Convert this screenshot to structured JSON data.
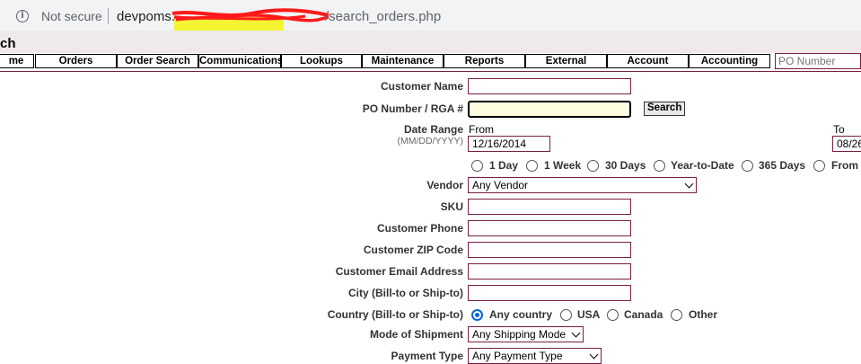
{
  "browser": {
    "not_secure": "Not secure",
    "url_host": "devpoms.",
    "url_path": "/search_orders.php"
  },
  "page": {
    "title": "ch"
  },
  "nav": {
    "items": [
      "me",
      "Orders",
      "Order Search",
      "Communications",
      "Lookups",
      "Maintenance",
      "Reports",
      "External",
      "Account",
      "Accounting"
    ],
    "po_placeholder": "PO Number"
  },
  "form": {
    "customer_name_label": "Customer Name",
    "po_label": "PO Number / RGA #",
    "search_button": "Search",
    "date_range_label": "Date Range",
    "date_format_hint": "(MM/DD/YYYY)",
    "from_label": "From",
    "from_value": "12/16/2014",
    "to_label": "To",
    "to_value": "08/26",
    "range_options": [
      "1 Day",
      "1 Week",
      "30 Days",
      "Year-to-Date",
      "365 Days",
      "From"
    ],
    "vendor_label": "Vendor",
    "vendor_value": "Any Vendor",
    "sku_label": "SKU",
    "phone_label": "Customer Phone",
    "zip_label": "Customer ZIP Code",
    "email_label": "Customer Email Address",
    "city_label": "City (Bill-to or Ship-to)",
    "country_label": "Country (Bill-to or Ship-to)",
    "country_options": [
      "Any country",
      "USA",
      "Canada",
      "Other"
    ],
    "country_selected": "Any country",
    "shipment_label": "Mode of Shipment",
    "shipment_value": "Any Shipping Mode",
    "payment_label": "Payment Type",
    "payment_value": "Any Payment Type"
  },
  "colors": {
    "accent_border": "#7a1e44",
    "radio_selected": "#0a66d8",
    "highlight": "#f5f51c",
    "redaction": "#ff1a1a"
  }
}
